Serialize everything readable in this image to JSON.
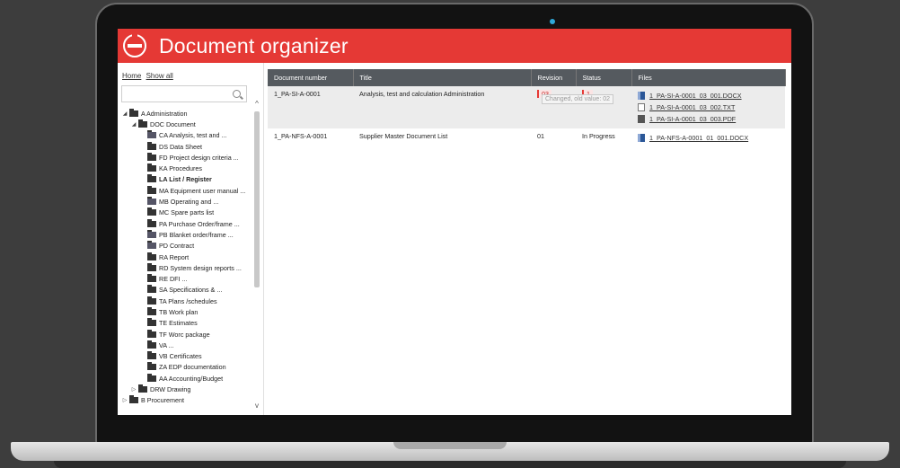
{
  "app": {
    "title": "Document organizer"
  },
  "sidebar": {
    "links": {
      "home": "Home",
      "show_all": "Show all"
    },
    "search": {
      "placeholder": ""
    },
    "tree": [
      {
        "level": 0,
        "toggle": "◢",
        "label": "A Administration"
      },
      {
        "level": 1,
        "toggle": "◢",
        "label": "DOC Document"
      },
      {
        "level": 2,
        "toggle": "",
        "label": "CA Analysis, test and ...",
        "special": true
      },
      {
        "level": 2,
        "toggle": "",
        "label": "DS Data Sheet"
      },
      {
        "level": 2,
        "toggle": "",
        "label": "FD Project design criteria ..."
      },
      {
        "level": 2,
        "toggle": "",
        "label": "KA Procedures"
      },
      {
        "level": 2,
        "toggle": "",
        "label": "LA List / Register",
        "bold": true
      },
      {
        "level": 2,
        "toggle": "",
        "label": "MA Equipment user manual ..."
      },
      {
        "level": 2,
        "toggle": "",
        "label": "MB Operating and ...",
        "special": true
      },
      {
        "level": 2,
        "toggle": "",
        "label": "MC Spare parts list"
      },
      {
        "level": 2,
        "toggle": "",
        "label": "PA Purchase Order/frame ..."
      },
      {
        "level": 2,
        "toggle": "",
        "label": "PB Blanket order/frame ...",
        "special": true
      },
      {
        "level": 2,
        "toggle": "",
        "label": "PD Contract",
        "special": true
      },
      {
        "level": 2,
        "toggle": "",
        "label": "RA Report"
      },
      {
        "level": 2,
        "toggle": "",
        "label": "RD System design reports ..."
      },
      {
        "level": 2,
        "toggle": "",
        "label": "RE DFI ..."
      },
      {
        "level": 2,
        "toggle": "",
        "label": "SA Specifications & ..."
      },
      {
        "level": 2,
        "toggle": "",
        "label": "TA Plans /schedules"
      },
      {
        "level": 2,
        "toggle": "",
        "label": "TB Work plan"
      },
      {
        "level": 2,
        "toggle": "",
        "label": "TE Estimates"
      },
      {
        "level": 2,
        "toggle": "",
        "label": "TF Worc package"
      },
      {
        "level": 2,
        "toggle": "",
        "label": "VA ..."
      },
      {
        "level": 2,
        "toggle": "",
        "label": "VB Certificates"
      },
      {
        "level": 2,
        "toggle": "",
        "label": "ZA EDP documentation"
      },
      {
        "level": 2,
        "toggle": "",
        "label": "AA Accounting/Budget"
      },
      {
        "level": 1,
        "toggle": "▷",
        "label": "DRW Drawing"
      },
      {
        "level": 0,
        "toggle": "▷",
        "label": "B Procurement"
      }
    ]
  },
  "table": {
    "columns": [
      "Document number",
      "Title",
      "Revision",
      "Status",
      "Files"
    ],
    "rows": [
      {
        "document_number": "1_PA-SI-A-0001",
        "title": "Analysis, test and calculation Administration",
        "revision": "03",
        "status": "1",
        "tooltip": "Changed, old value: 02",
        "files": [
          {
            "type": "docx",
            "name": "1_PA-SI-A-0001_03_001.DOCX"
          },
          {
            "type": "txt",
            "name": "1_PA-SI-A-0001_03_002.TXT"
          },
          {
            "type": "pdf",
            "name": "1_PA-SI-A-0001_03_003.PDF"
          }
        ]
      },
      {
        "document_number": "1_PA-NFS-A-0001",
        "title": "Supplier Master Document List",
        "revision": "01",
        "status": "In Progress",
        "files": [
          {
            "type": "docx",
            "name": "1_PA-NFS-A-0001_01_001.DOCX"
          }
        ]
      }
    ]
  },
  "colors": {
    "accent": "#e53935",
    "header_bg": "#555a5f"
  }
}
